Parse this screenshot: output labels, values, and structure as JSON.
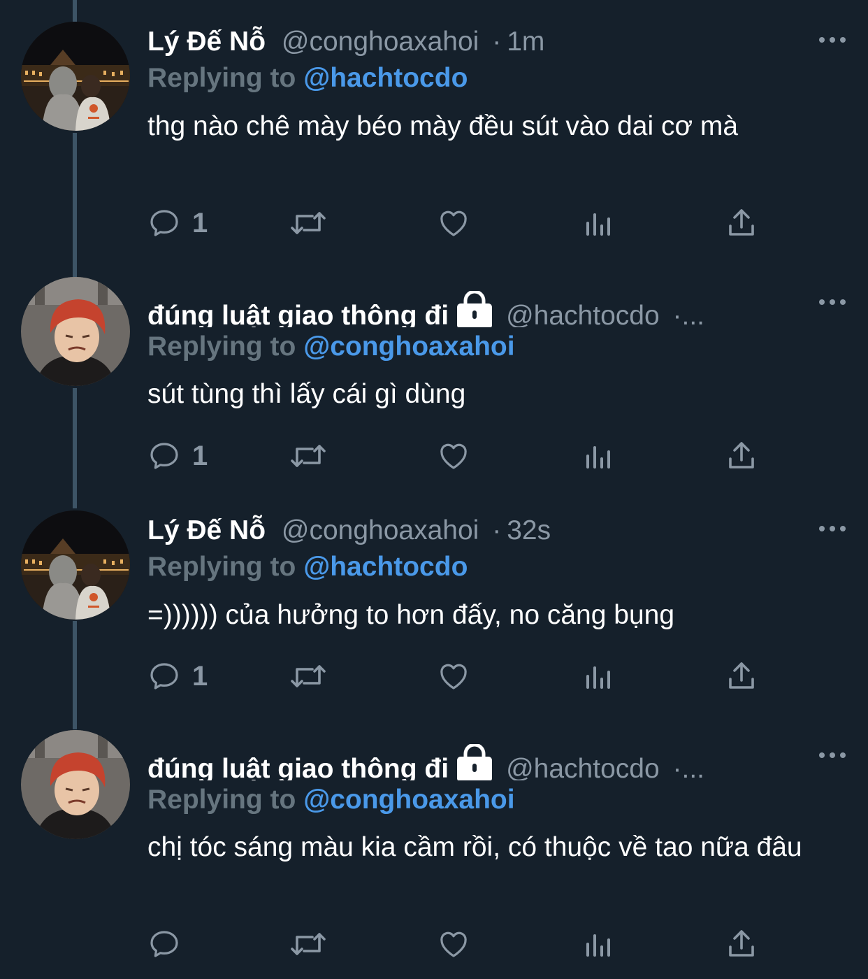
{
  "tweets": [
    {
      "author": "Lý Đế Nỗ",
      "handle": "@conghoaxahoi",
      "separator": "·",
      "time": "1m",
      "replying_prefix": "Replying to",
      "replying_to": "@hachtocdo",
      "text": "thg nào chê mày béo mày đều sút vào dai cơ mà",
      "reply_count": "1",
      "locked": false,
      "avatar": "night-street-two-people-avatar"
    },
    {
      "author": "đúng luật giao thông đi",
      "handle": "@hachtocdo",
      "separator": "·...",
      "time": "",
      "replying_prefix": "Replying to",
      "replying_to": "@conghoaxahoi",
      "text": "sút tùng thì lấy cái gì dùng",
      "reply_count": "1",
      "locked": true,
      "avatar": "red-hair-person-avatar"
    },
    {
      "author": "Lý Đế Nỗ",
      "handle": "@conghoaxahoi",
      "separator": "·",
      "time": "32s",
      "replying_prefix": "Replying to",
      "replying_to": "@hachtocdo",
      "text": "=)))))) của hưởng to hơn đấy, no căng bụng",
      "reply_count": "1",
      "locked": false,
      "avatar": "night-street-two-people-avatar"
    },
    {
      "author": "đúng luật giao thông đi",
      "handle": "@hachtocdo",
      "separator": "·...",
      "time": "",
      "replying_prefix": "Replying to",
      "replying_to": "@conghoaxahoi",
      "text": "chị tóc sáng màu kia cầm rồi, có thuộc về tao nữa đâu",
      "reply_count": "",
      "locked": true,
      "avatar": "red-hair-person-avatar"
    }
  ],
  "colors": {
    "background": "#15202b",
    "text": "#ffffff",
    "secondary": "#8b98a5",
    "mention": "#4a99e9",
    "thread_line": "#3d5466"
  }
}
